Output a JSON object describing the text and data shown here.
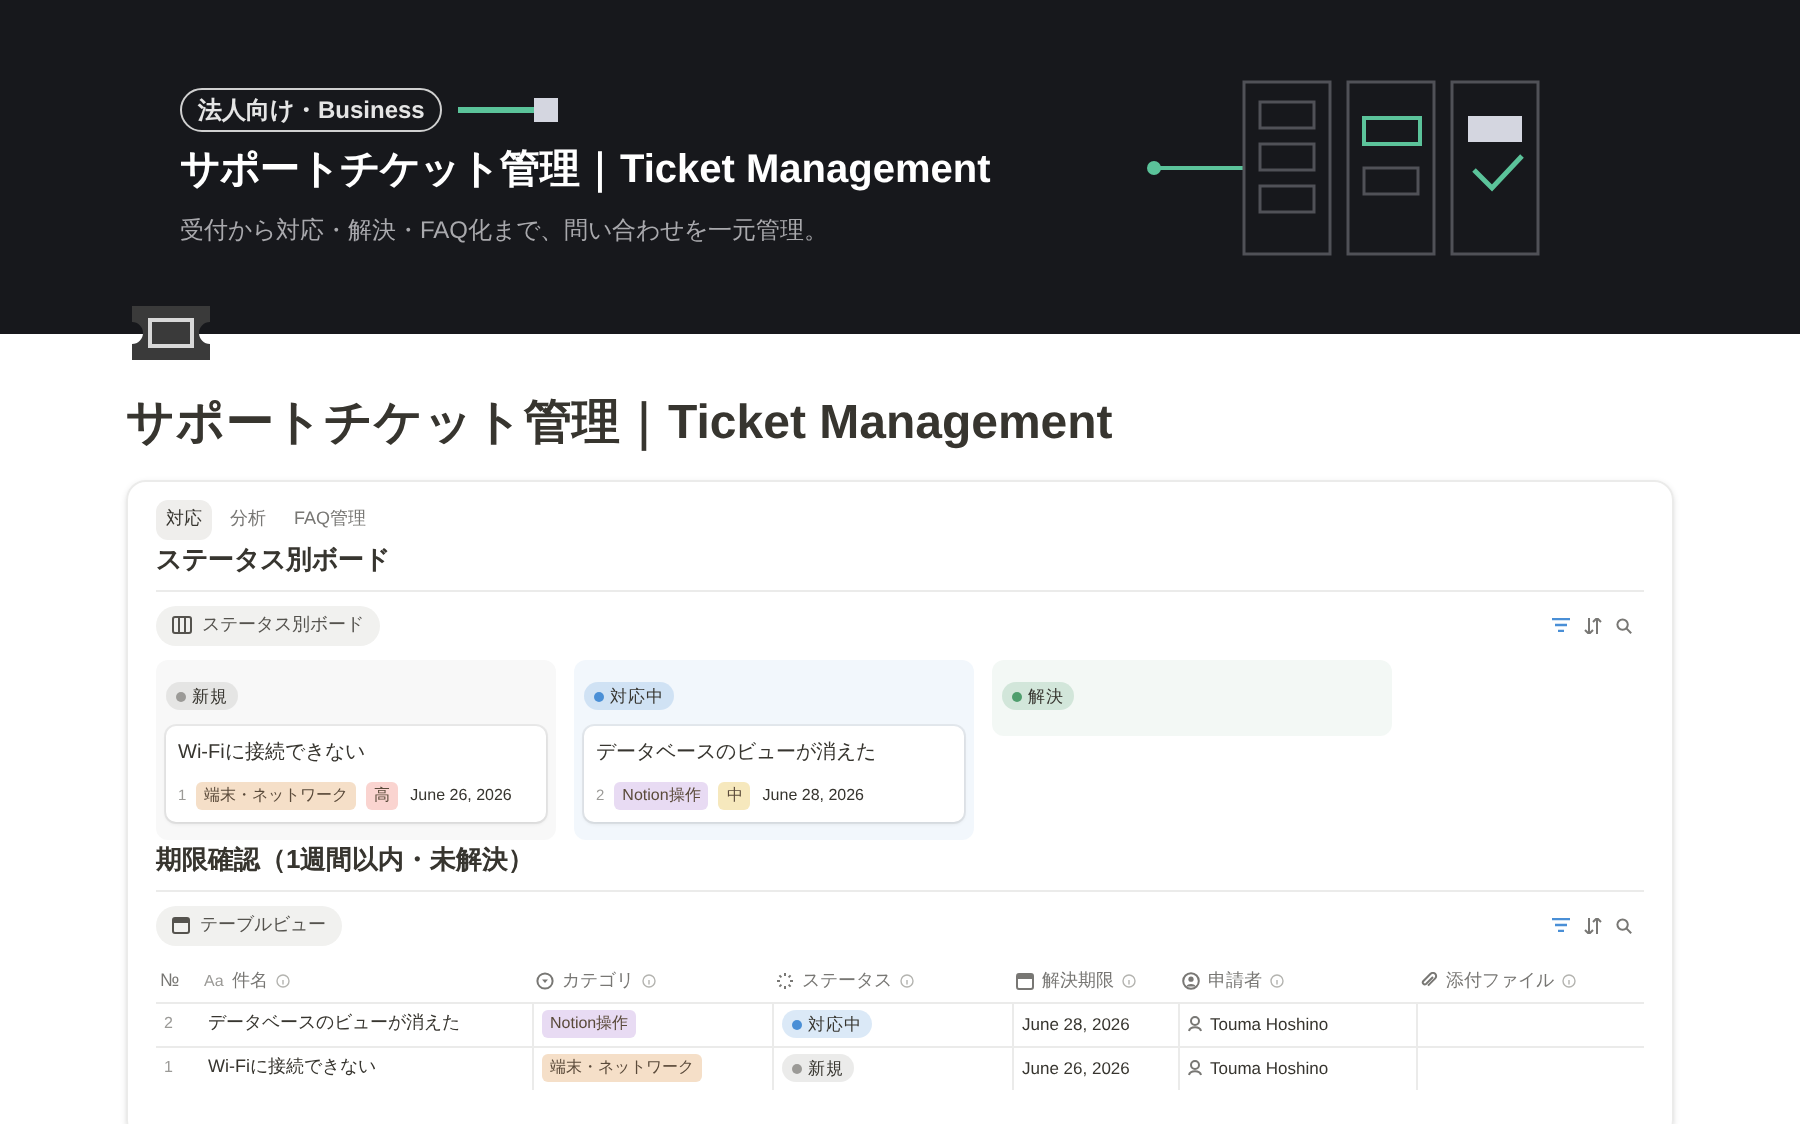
{
  "banner": {
    "badge": "法人向け・Business",
    "title": "サポートチケット管理｜Ticket Management",
    "subtitle": "受付から対応・解決・FAQ化まで、問い合わせを一元管理。"
  },
  "page_title": "サポートチケット管理｜Ticket Management",
  "tabs": [
    {
      "label": "対応",
      "selected": true
    },
    {
      "label": "分析",
      "selected": false
    },
    {
      "label": "FAQ管理",
      "selected": false
    }
  ],
  "board": {
    "heading": "ステータス別ボード",
    "view": "ステータス別ボード",
    "columns": [
      {
        "status": "新規",
        "color": "#9b9a97",
        "cards": [
          {
            "title": "Wi-Fiに接続できない",
            "number": "1",
            "tags": [
              {
                "label": "端末・ネットワーク",
                "color": "#f5dfc8"
              },
              {
                "label": "高",
                "color": "#fad4d0"
              }
            ],
            "date": "June 26, 2026"
          }
        ]
      },
      {
        "status": "対応中",
        "color": "#4a8fd6",
        "cards": [
          {
            "title": "データベースのビューが消えた",
            "number": "2",
            "tags": [
              {
                "label": "Notion操作",
                "color": "#e8dbf3"
              },
              {
                "label": "中",
                "color": "#f6e8bd"
              }
            ],
            "date": "June 28, 2026"
          }
        ]
      },
      {
        "status": "解決",
        "color": "#4f9e6d"
      }
    ]
  },
  "table": {
    "heading": "期限確認（1週間以内・未解決）",
    "view": "テーブルビュー",
    "columns": [
      {
        "kind": "number",
        "label": "№"
      },
      {
        "kind": "title",
        "icon_text": "Aa",
        "label": "件名"
      },
      {
        "kind": "select",
        "label": "カテゴリ"
      },
      {
        "kind": "status",
        "label": "ステータス"
      },
      {
        "kind": "date",
        "label": "解決期限"
      },
      {
        "kind": "person",
        "label": "申請者"
      },
      {
        "kind": "file",
        "label": "添付ファイル"
      }
    ],
    "rows": [
      {
        "number": "2",
        "title": "データベースのビューが消えた",
        "category": {
          "label": "Notion操作",
          "color": "#e8dbf3"
        },
        "status": {
          "label": "対応中",
          "color": "#4a8fd6"
        },
        "due": "June 28, 2026",
        "requester": "Touma Hoshino"
      },
      {
        "number": "1",
        "title": "Wi-Fiに接続できない",
        "category": {
          "label": "端末・ネットワーク",
          "color": "#f5dfc8"
        },
        "status": {
          "label": "新規",
          "color": "#9b9a97"
        },
        "due": "June 26, 2026",
        "requester": "Touma Hoshino"
      }
    ]
  }
}
